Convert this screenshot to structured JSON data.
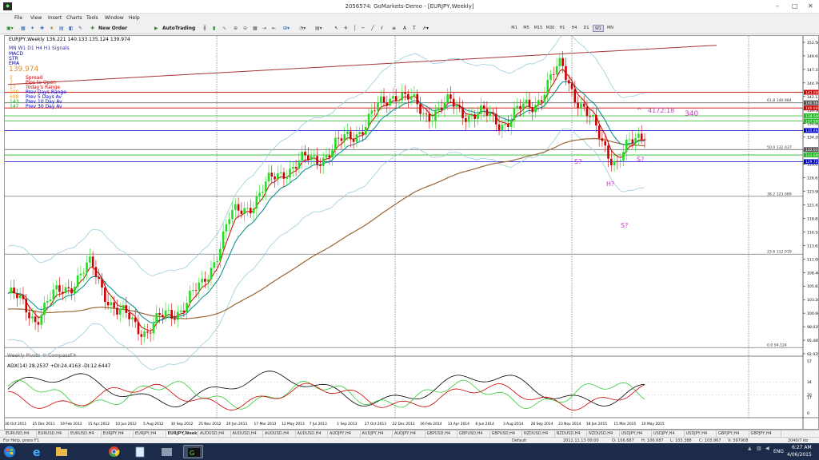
{
  "window": {
    "title": "2056574: GoMarkets-Demo - [EURJPY,Weekly]"
  },
  "menu": [
    "File",
    "View",
    "Insert",
    "Charts",
    "Tools",
    "Window",
    "Help"
  ],
  "toolbar": {
    "new_order": "New Order",
    "autotrading": "AutoTrading",
    "timeframes": [
      "M1",
      "M5",
      "M15",
      "M30",
      "H1",
      "H4",
      "D1",
      "W1",
      "MN"
    ]
  },
  "chart": {
    "header": "EURJPY,Weekly  136.221 140.133 135.124 139.974",
    "tf_row": "MN  W1  D1  H4  H1  Signals",
    "legend_items": [
      "MACD",
      "STR",
      "EMA"
    ],
    "price_big": "139.974",
    "info_rows": [
      {
        "v": "2",
        "t": "Spread"
      },
      {
        "v": "7",
        "t": "Pips to Open"
      },
      {
        "v": "17",
        "t": "Today's Range"
      },
      {
        "v": "209",
        "t": "Prev Days Range"
      },
      {
        "v": "688",
        "t": "Prev 5 Days Av"
      },
      {
        "v": "143",
        "t": "Prev 10 Day Av"
      },
      {
        "v": "147",
        "t": "Prev 30 Day Av"
      }
    ],
    "annotations": {
      "pips": "4172:18",
      "count": "340",
      "s1": "S?",
      "s2": "S?",
      "h": "H?",
      "s3": "S?",
      "caret": "^"
    },
    "fib_labels": [
      "61.8  140.984",
      "50.0  132.037",
      "38.2  123.089",
      "23.6  112.019",
      "0.0  94.124"
    ],
    "watermark": "Weekly Pivots © CompassFX",
    "adx_header": "ADX(14) 28.2537 +DI:24.4163 -DI:12.6447",
    "price_axis": [
      "152.565",
      "149.935",
      "147.310",
      "144.760",
      "142.135",
      "139.560",
      "136.880",
      "134.285",
      "131.660",
      "129.035",
      "126.610",
      "123.985",
      "121.435",
      "118.810",
      "116.185",
      "113.635",
      "111.085",
      "108.460",
      "105.835",
      "103.285",
      "100.660",
      "98.035",
      "95.485",
      "92.935"
    ],
    "adx_axis": [
      "57",
      "34",
      "20",
      "17",
      "0"
    ],
    "x_axis": [
      "30 Oct 2011",
      "25 Dec 2011",
      "19 Feb 2012",
      "15 Apr 2012",
      "10 Jun 2012",
      "5 Aug 2012",
      "30 Sep 2012",
      "25 Nov 2012",
      "20 Jan 2013",
      "17 Mar 2013",
      "12 May 2013",
      "7 Jul 2013",
      "1 Sep 2013",
      "27 Oct 2013",
      "22 Dec 2013",
      "16 Feb 2014",
      "13 Apr 2014",
      "8 Jun 2014",
      "3 Aug 2014",
      "28 Sep 2014",
      "23 Nov 2014",
      "18 Jan 2015",
      "15 Mar 2015",
      "10 May 2015"
    ],
    "hline_labels": [
      {
        "text": "143.000",
        "color": "#cc0000"
      },
      {
        "text": "140.984",
        "color": "#555555"
      },
      {
        "text": "140.000",
        "color": "#cc0000"
      },
      {
        "text": "138.500",
        "color": "#22bb22"
      },
      {
        "text": "137.500",
        "color": "#22bb22"
      },
      {
        "text": "135.694",
        "color": "#0000cc"
      },
      {
        "text": "132.037",
        "color": "#555555"
      },
      {
        "text": "131.000",
        "color": "#22bb22"
      },
      {
        "text": "129.722",
        "color": "#0000cc"
      }
    ],
    "colors": {
      "bull": "#22dd22",
      "bear": "#cc0000",
      "ema_fast": "#cc0000",
      "ema_mid": "#008888",
      "ema_long": "#996633",
      "bands": "#99ccdd",
      "adx": "#000000",
      "plus_di": "#33cc33",
      "minus_di": "#cc0000",
      "annot": "#cc33cc"
    }
  },
  "chart_data": {
    "type": "candlestick",
    "symbol": "EURJPY",
    "period": "Weekly",
    "ylim": [
      92.935,
      152.565
    ],
    "x": [
      "30 Oct 2011",
      "25 Dec 2011",
      "19 Feb 2012",
      "15 Apr 2012",
      "10 Jun 2012",
      "5 Aug 2012",
      "30 Sep 2012",
      "25 Nov 2012",
      "20 Jan 2013",
      "17 Mar 2013",
      "12 May 2013",
      "7 Jul 2013",
      "1 Sep 2013",
      "27 Oct 2013",
      "22 Dec 2013",
      "16 Feb 2014",
      "13 Apr 2014",
      "8 Jun 2014",
      "3 Aug 2014",
      "28 Sep 2014",
      "23 Nov 2014",
      "18 Jan 2015",
      "15 Mar 2015",
      "10 May 2015"
    ],
    "close": [
      104.5,
      100.0,
      105.5,
      109.5,
      100.5,
      97.5,
      101.0,
      105.5,
      118.5,
      123.0,
      128.5,
      130.0,
      133.0,
      137.5,
      143.5,
      139.0,
      140.5,
      138.5,
      137.5,
      141.0,
      148.0,
      137.5,
      129.5,
      136.0
    ],
    "last": {
      "open": 136.221,
      "high": 140.133,
      "low": 135.124,
      "close": 139.974
    },
    "fib_levels": [
      {
        "pct": 61.8,
        "price": 140.984
      },
      {
        "pct": 50.0,
        "price": 132.037
      },
      {
        "pct": 38.2,
        "price": 123.089
      },
      {
        "pct": 23.6,
        "price": 112.019
      },
      {
        "pct": 0.0,
        "price": 94.124
      }
    ],
    "hlines": [
      {
        "price": 143.0,
        "color": "#cc0000"
      },
      {
        "price": 140.984,
        "color": "#555555"
      },
      {
        "price": 140.0,
        "color": "#cc0000"
      },
      {
        "price": 138.5,
        "color": "#22bb22"
      },
      {
        "price": 137.5,
        "color": "#22bb22"
      },
      {
        "price": 135.694,
        "color": "#0000cc"
      },
      {
        "price": 132.037,
        "color": "#555555"
      },
      {
        "price": 131.0,
        "color": "#22bb22"
      },
      {
        "price": 129.722,
        "color": "#0000cc"
      }
    ],
    "trendline": {
      "from": {
        "x": "30 Oct 2011",
        "y": 144.5
      },
      "to": {
        "x": "10 May 2015",
        "y": 152.0
      }
    },
    "adx": {
      "current": 28.2537,
      "plus_di": 24.4163,
      "minus_di": 12.6447,
      "ylim": [
        0,
        57
      ]
    }
  },
  "tabs": [
    "EURUSD,H4",
    "EURUSD,H4",
    "EURUSD,H4",
    "EURJPY,H4",
    "EURJPY,H4",
    "EURJPY,Weekly",
    "AUDUSD,H4",
    "AUDUSD,H4",
    "AUDUSD,H4",
    "AUDUSD,H4",
    "AUDJPY,H4",
    "AUDJPY,H4",
    "AUDJPY,H4",
    "GBPUSD,H4",
    "GBPUSD,H4",
    "GBPUSD,H4",
    "NZDUSD,H4",
    "NZDUSD,H4",
    "NZDUSD,H4",
    "USDJPY,H4",
    "USDJPY,H4",
    "USDJPY,H4",
    "GBPJPY,H4",
    "GBPJPY,H4"
  ],
  "status": {
    "help": "For Help, press F1",
    "profile": "Default",
    "time": "2011.11.13 00:00",
    "o": "O: 106.687",
    "h": "H: 106.687",
    "l": "L: 103.388",
    "c": "C: 103.967",
    "v": "V: 397908",
    "kb": "2040/7 kb"
  },
  "taskbar": {
    "lang": "ENG",
    "time": "6:27 AM",
    "date": "4/06/2015"
  }
}
